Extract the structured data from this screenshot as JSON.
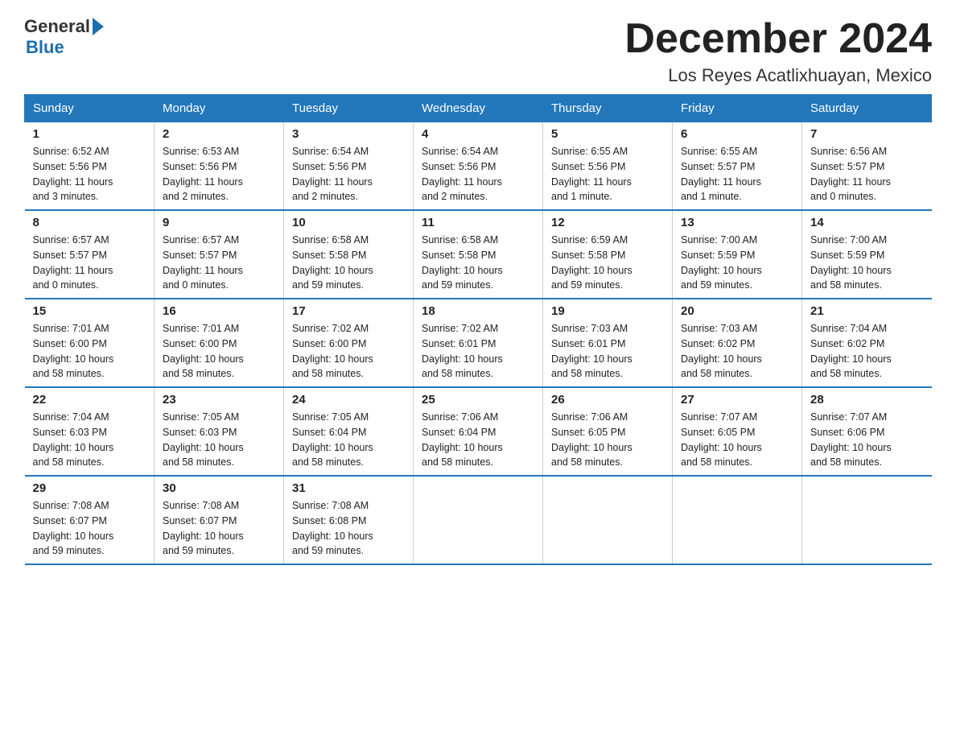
{
  "logo": {
    "general": "General",
    "blue": "Blue"
  },
  "header": {
    "title": "December 2024",
    "subtitle": "Los Reyes Acatlixhuayan, Mexico"
  },
  "weekdays": [
    "Sunday",
    "Monday",
    "Tuesday",
    "Wednesday",
    "Thursday",
    "Friday",
    "Saturday"
  ],
  "weeks": [
    [
      {
        "day": "1",
        "sunrise": "6:52 AM",
        "sunset": "5:56 PM",
        "daylight": "11 hours and 3 minutes."
      },
      {
        "day": "2",
        "sunrise": "6:53 AM",
        "sunset": "5:56 PM",
        "daylight": "11 hours and 2 minutes."
      },
      {
        "day": "3",
        "sunrise": "6:54 AM",
        "sunset": "5:56 PM",
        "daylight": "11 hours and 2 minutes."
      },
      {
        "day": "4",
        "sunrise": "6:54 AM",
        "sunset": "5:56 PM",
        "daylight": "11 hours and 2 minutes."
      },
      {
        "day": "5",
        "sunrise": "6:55 AM",
        "sunset": "5:56 PM",
        "daylight": "11 hours and 1 minute."
      },
      {
        "day": "6",
        "sunrise": "6:55 AM",
        "sunset": "5:57 PM",
        "daylight": "11 hours and 1 minute."
      },
      {
        "day": "7",
        "sunrise": "6:56 AM",
        "sunset": "5:57 PM",
        "daylight": "11 hours and 0 minutes."
      }
    ],
    [
      {
        "day": "8",
        "sunrise": "6:57 AM",
        "sunset": "5:57 PM",
        "daylight": "11 hours and 0 minutes."
      },
      {
        "day": "9",
        "sunrise": "6:57 AM",
        "sunset": "5:57 PM",
        "daylight": "11 hours and 0 minutes."
      },
      {
        "day": "10",
        "sunrise": "6:58 AM",
        "sunset": "5:58 PM",
        "daylight": "10 hours and 59 minutes."
      },
      {
        "day": "11",
        "sunrise": "6:58 AM",
        "sunset": "5:58 PM",
        "daylight": "10 hours and 59 minutes."
      },
      {
        "day": "12",
        "sunrise": "6:59 AM",
        "sunset": "5:58 PM",
        "daylight": "10 hours and 59 minutes."
      },
      {
        "day": "13",
        "sunrise": "7:00 AM",
        "sunset": "5:59 PM",
        "daylight": "10 hours and 59 minutes."
      },
      {
        "day": "14",
        "sunrise": "7:00 AM",
        "sunset": "5:59 PM",
        "daylight": "10 hours and 58 minutes."
      }
    ],
    [
      {
        "day": "15",
        "sunrise": "7:01 AM",
        "sunset": "6:00 PM",
        "daylight": "10 hours and 58 minutes."
      },
      {
        "day": "16",
        "sunrise": "7:01 AM",
        "sunset": "6:00 PM",
        "daylight": "10 hours and 58 minutes."
      },
      {
        "day": "17",
        "sunrise": "7:02 AM",
        "sunset": "6:00 PM",
        "daylight": "10 hours and 58 minutes."
      },
      {
        "day": "18",
        "sunrise": "7:02 AM",
        "sunset": "6:01 PM",
        "daylight": "10 hours and 58 minutes."
      },
      {
        "day": "19",
        "sunrise": "7:03 AM",
        "sunset": "6:01 PM",
        "daylight": "10 hours and 58 minutes."
      },
      {
        "day": "20",
        "sunrise": "7:03 AM",
        "sunset": "6:02 PM",
        "daylight": "10 hours and 58 minutes."
      },
      {
        "day": "21",
        "sunrise": "7:04 AM",
        "sunset": "6:02 PM",
        "daylight": "10 hours and 58 minutes."
      }
    ],
    [
      {
        "day": "22",
        "sunrise": "7:04 AM",
        "sunset": "6:03 PM",
        "daylight": "10 hours and 58 minutes."
      },
      {
        "day": "23",
        "sunrise": "7:05 AM",
        "sunset": "6:03 PM",
        "daylight": "10 hours and 58 minutes."
      },
      {
        "day": "24",
        "sunrise": "7:05 AM",
        "sunset": "6:04 PM",
        "daylight": "10 hours and 58 minutes."
      },
      {
        "day": "25",
        "sunrise": "7:06 AM",
        "sunset": "6:04 PM",
        "daylight": "10 hours and 58 minutes."
      },
      {
        "day": "26",
        "sunrise": "7:06 AM",
        "sunset": "6:05 PM",
        "daylight": "10 hours and 58 minutes."
      },
      {
        "day": "27",
        "sunrise": "7:07 AM",
        "sunset": "6:05 PM",
        "daylight": "10 hours and 58 minutes."
      },
      {
        "day": "28",
        "sunrise": "7:07 AM",
        "sunset": "6:06 PM",
        "daylight": "10 hours and 58 minutes."
      }
    ],
    [
      {
        "day": "29",
        "sunrise": "7:08 AM",
        "sunset": "6:07 PM",
        "daylight": "10 hours and 59 minutes."
      },
      {
        "day": "30",
        "sunrise": "7:08 AM",
        "sunset": "6:07 PM",
        "daylight": "10 hours and 59 minutes."
      },
      {
        "day": "31",
        "sunrise": "7:08 AM",
        "sunset": "6:08 PM",
        "daylight": "10 hours and 59 minutes."
      },
      null,
      null,
      null,
      null
    ]
  ],
  "labels": {
    "sunrise": "Sunrise:",
    "sunset": "Sunset:",
    "daylight": "Daylight:"
  }
}
